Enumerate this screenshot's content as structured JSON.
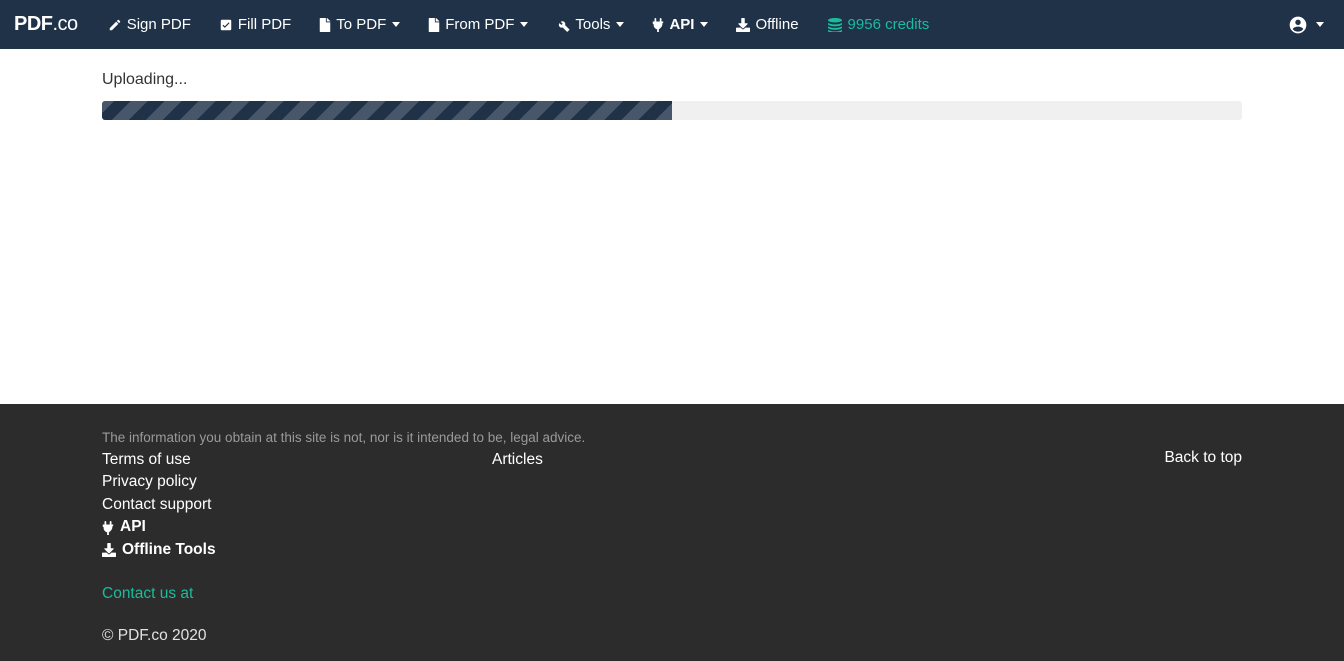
{
  "brand": {
    "bold": "PDF",
    "thin": ".co"
  },
  "nav": {
    "sign": {
      "label": "Sign PDF"
    },
    "fill": {
      "label": "Fill PDF"
    },
    "topdf": {
      "label": "To PDF"
    },
    "frompdf": {
      "label": "From PDF"
    },
    "tools": {
      "label": "Tools"
    },
    "api": {
      "label": "API"
    },
    "offline": {
      "label": "Offline"
    },
    "credits": {
      "label": "9956 credits"
    }
  },
  "main": {
    "status": "Uploading...",
    "progress_percent": 50
  },
  "footer": {
    "disclaimer": "The information you obtain at this site is not, nor is it intended to be, legal advice.",
    "col1": {
      "terms": "Terms of use",
      "privacy": "Privacy policy",
      "support": "Contact support",
      "api": "API",
      "offline": "Offline Tools"
    },
    "col2": {
      "articles": "Articles"
    },
    "backtop": "Back to top",
    "contact": "Contact us at",
    "copyright": "© PDF.co 2020"
  }
}
